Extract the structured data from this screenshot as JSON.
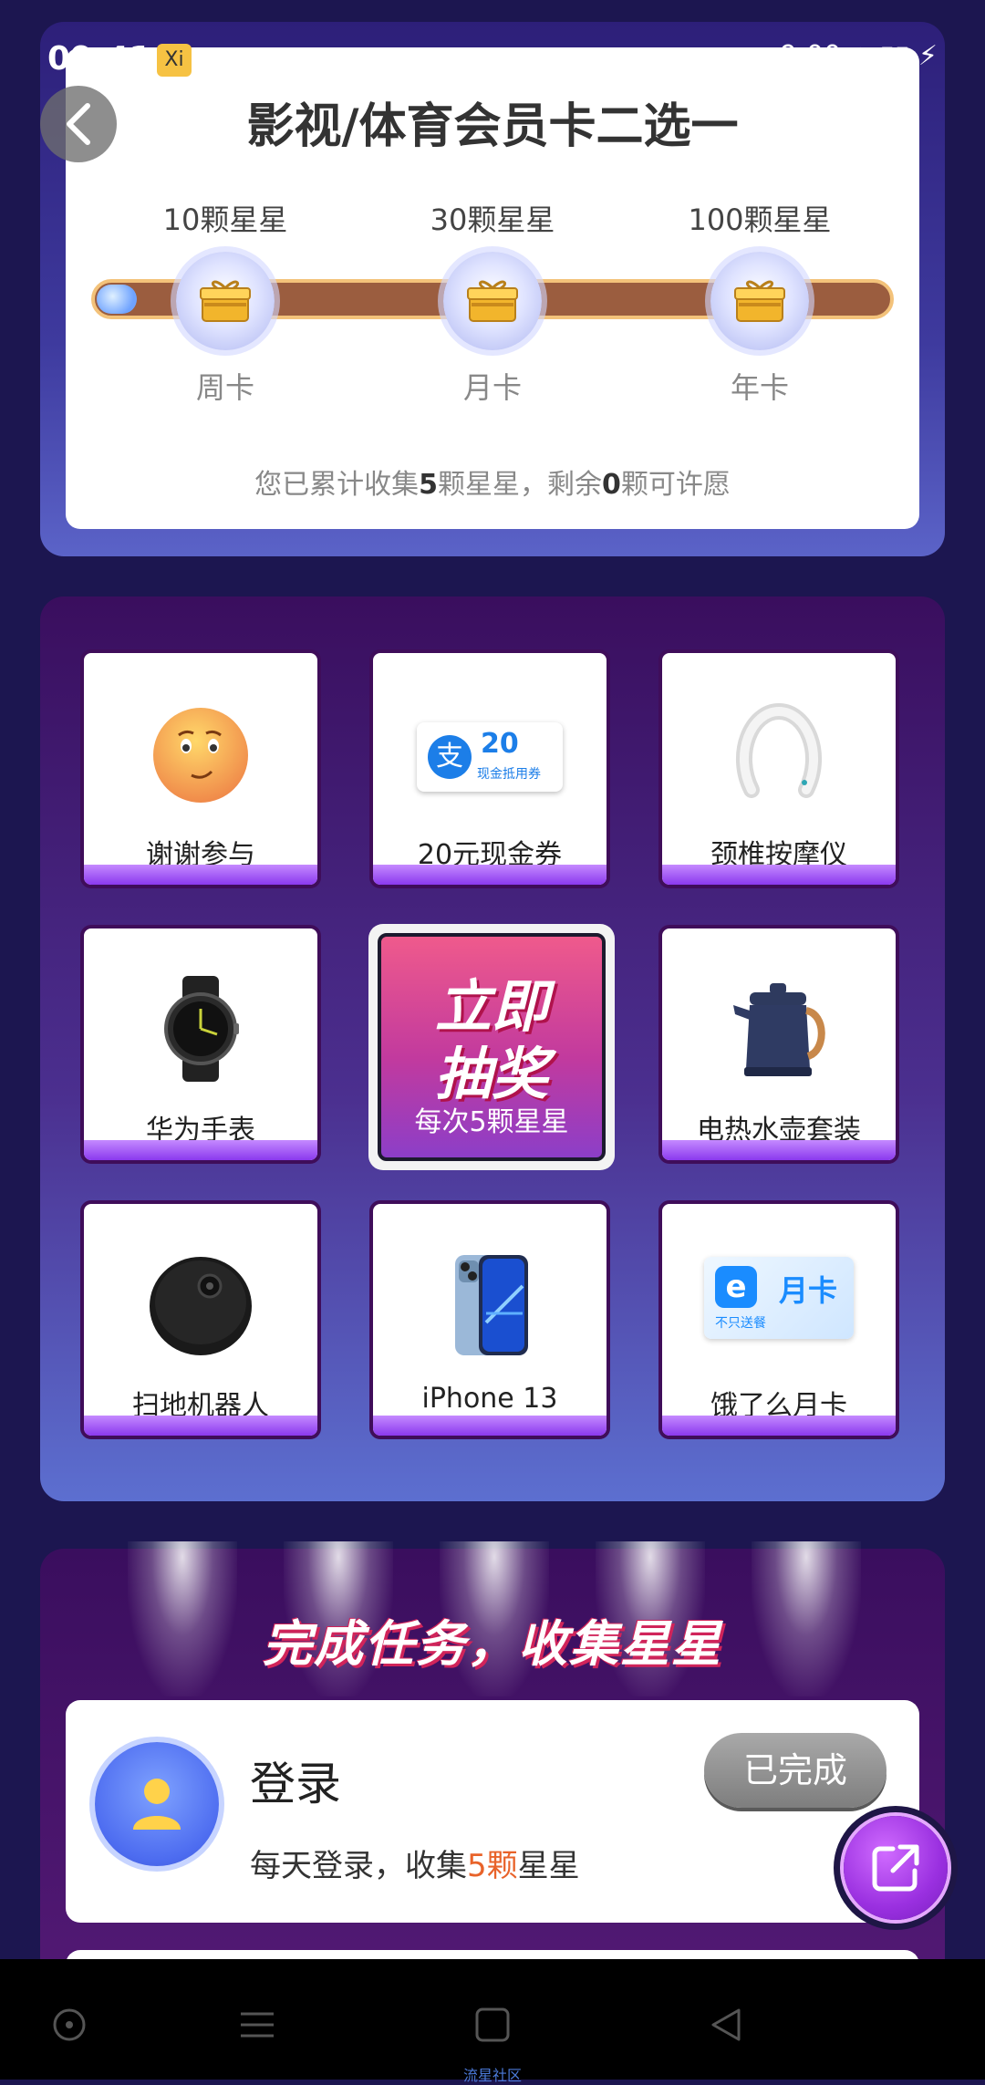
{
  "status": {
    "time": "09:41",
    "badge": "Xi",
    "right": "9:00 ▲ ▮▮ ⚡"
  },
  "header": {
    "title": "影视/体育会员卡二选一"
  },
  "milestones": [
    {
      "stars": "10颗星星",
      "card": "周卡"
    },
    {
      "stars": "30颗星星",
      "card": "月卡"
    },
    {
      "stars": "100颗星星",
      "card": "年卡"
    }
  ],
  "progress": {
    "collected": 5,
    "remaining": 0,
    "fraction": 0.05
  },
  "summary": {
    "prefix": "您已累计收集",
    "collected": "5",
    "middle": "颗星星，剩余",
    "remaining": "0",
    "suffix": "颗可许愿"
  },
  "prizes": [
    {
      "label": "谢谢参与",
      "icon": "emoji-icon"
    },
    {
      "label": "20元现金券",
      "icon": "alipay-coupon-icon",
      "coupon_value": "20",
      "coupon_text": "现金抵用券",
      "coupon_logo": "支"
    },
    {
      "label": "颈椎按摩仪",
      "icon": "neck-massager-icon"
    },
    {
      "label": "华为手表",
      "icon": "smartwatch-icon"
    },
    {
      "label": "电热水壶套装",
      "icon": "kettle-icon"
    },
    {
      "label": "扫地机器人",
      "icon": "robot-vacuum-icon"
    },
    {
      "label": "iPhone 13",
      "icon": "iphone-icon"
    },
    {
      "label": "饿了么月卡",
      "icon": "eleme-card-icon",
      "card_text": "月卡",
      "card_sub": "不只送餐"
    }
  ],
  "draw_button": {
    "line1": "立即",
    "line2": "抽奖",
    "sub": "每次5颗星星"
  },
  "tasks": {
    "heading": "完成任务，收集星星",
    "items": [
      {
        "title": "登录",
        "desc_prefix": "每天登录，收集",
        "desc_highlight": "5颗",
        "desc_suffix": "星星",
        "button": "已完成"
      }
    ]
  },
  "nav": {
    "caption": "流星社区"
  },
  "colors": {
    "accent_purple": "#8a39ee",
    "highlight_orange": "#e8632a",
    "track_brown": "#9b5d3f",
    "page_bg": "#1c1650"
  }
}
